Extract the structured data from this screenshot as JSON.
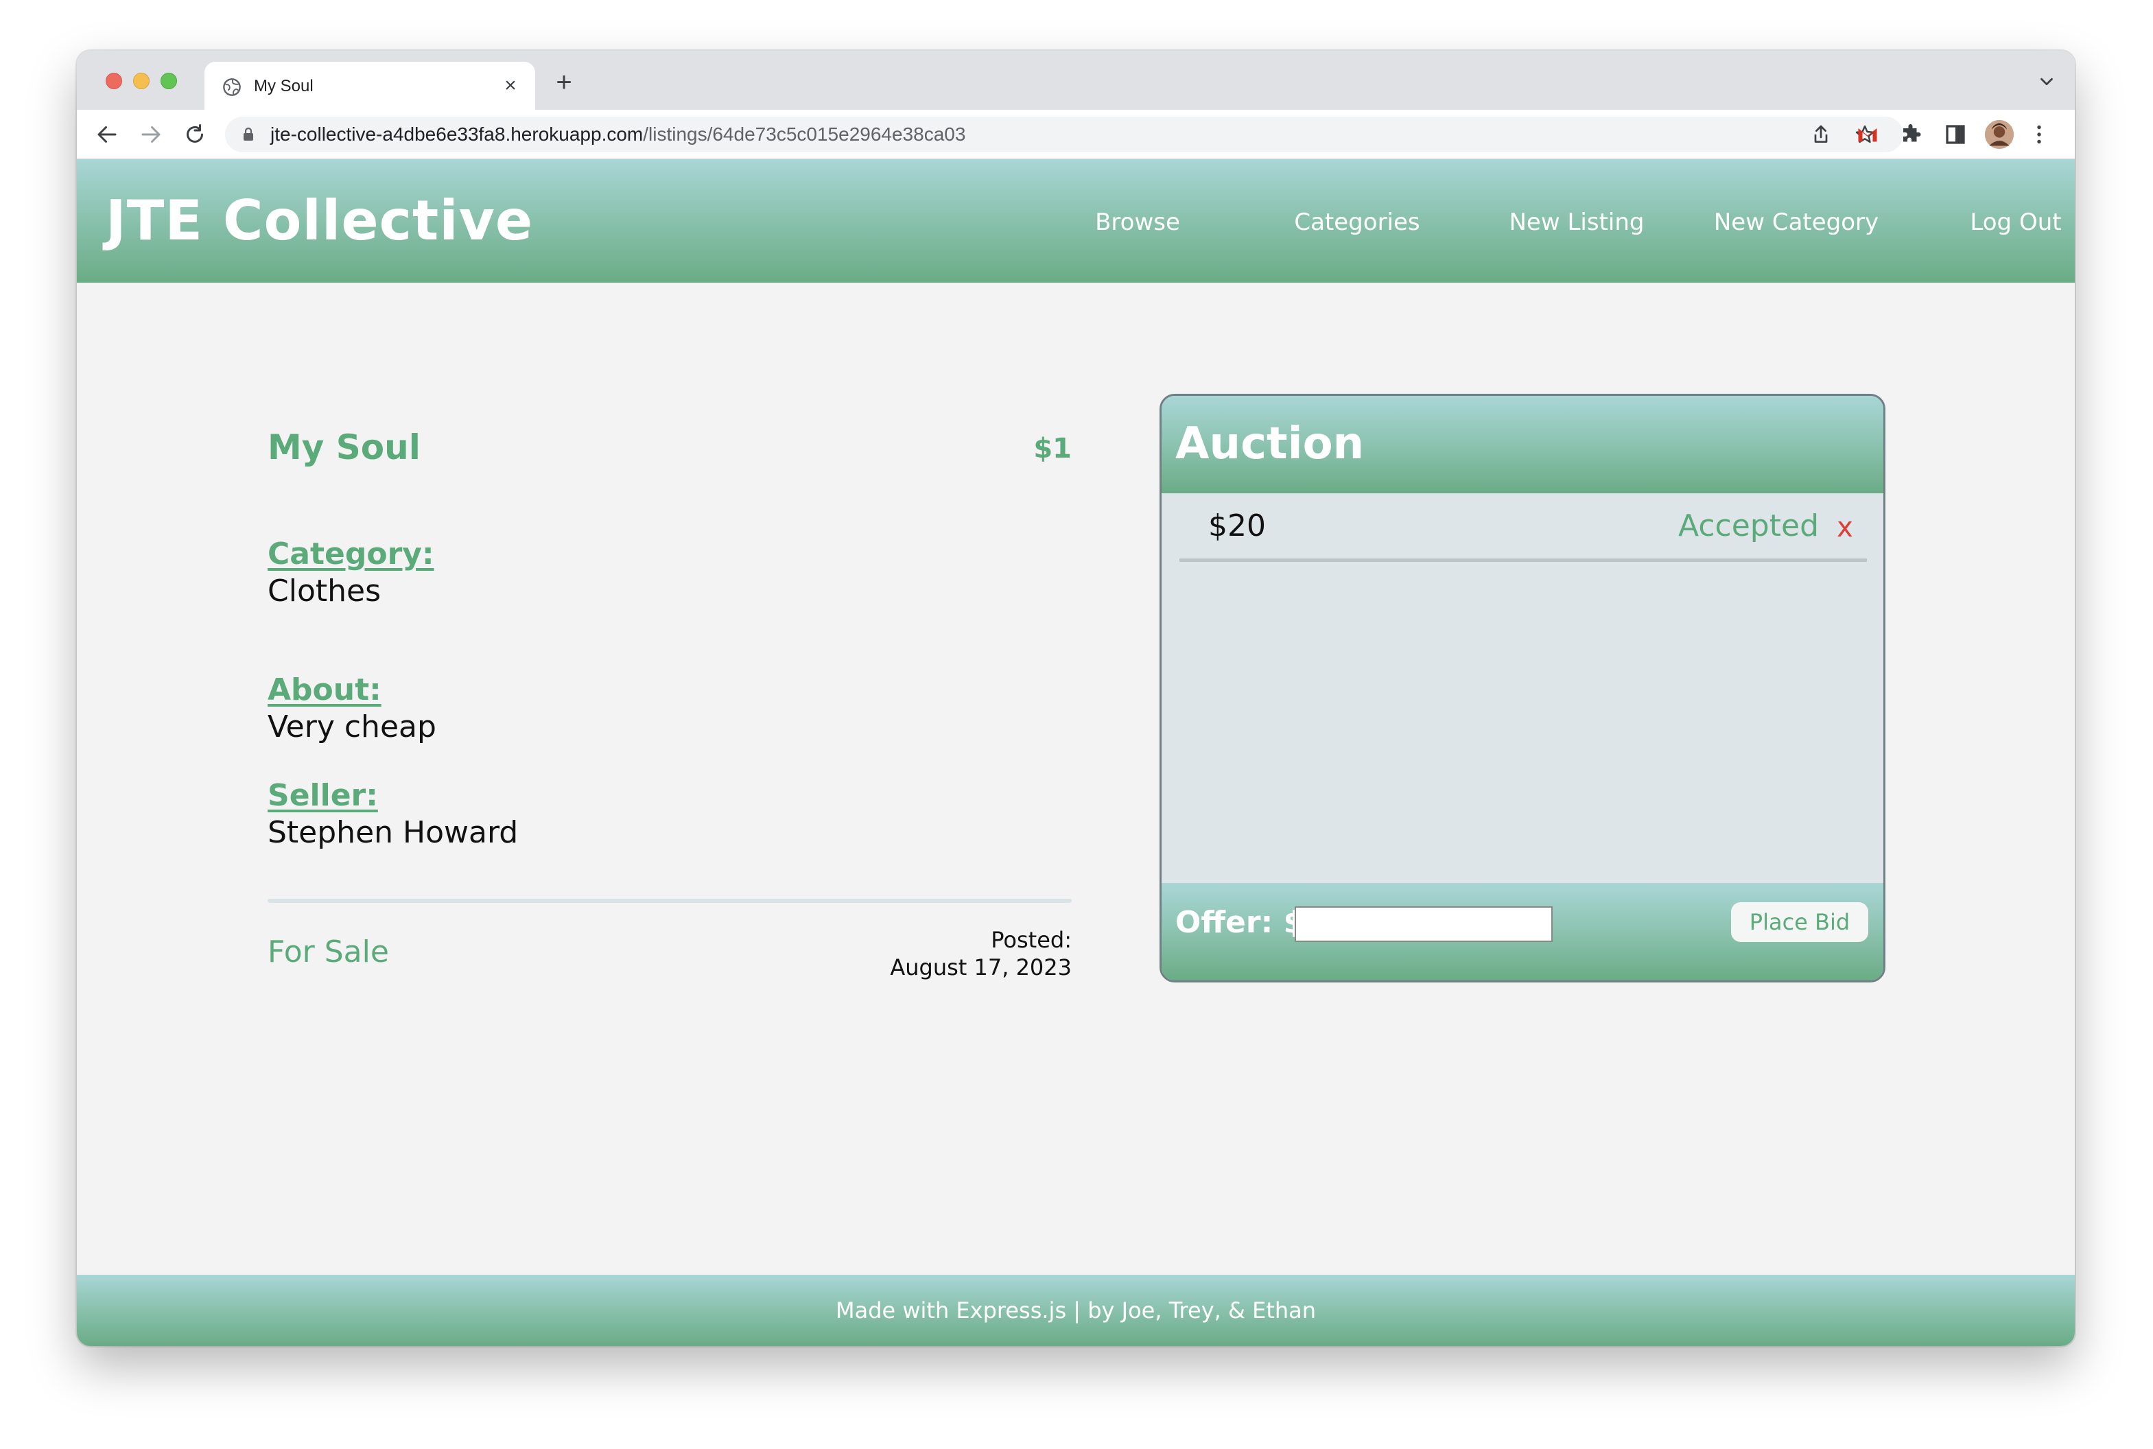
{
  "browser": {
    "tab_title": "My Soul",
    "tab_close": "×",
    "new_tab": "+",
    "url_host": "jte-collective-a4dbe6e33fa8.herokuapp.com",
    "url_path": "/listings/64de73c5c015e2964e38ca03",
    "icons": [
      "back-icon",
      "forward-icon",
      "reload-icon",
      "lock-icon",
      "share-icon",
      "bookmark-star-icon",
      "gmail-icon",
      "extensions-icon",
      "side-panel-icon",
      "profile-avatar",
      "more-menu-icon",
      "tab-search-icon"
    ]
  },
  "site": {
    "brand": "JTE Collective",
    "nav": {
      "browse": "Browse",
      "categories": "Categories",
      "new_listing": "New Listing",
      "new_category": "New Category",
      "log_out": "Log Out"
    },
    "footer": "Made with Express.js | by Joe, Trey, & Ethan"
  },
  "listing": {
    "title": "My Soul",
    "price": "$1",
    "category_label": "Category:",
    "category_value": "Clothes",
    "about_label": "About:",
    "about_value": "Very cheap",
    "seller_label": "Seller:",
    "seller_value": "Stephen Howard",
    "status": "For Sale",
    "posted_label": "Posted:",
    "posted_date": "August 17, 2023"
  },
  "auction": {
    "title": "Auction",
    "bids": [
      {
        "amount": "$20",
        "status": "Accepted",
        "delete": "x"
      }
    ],
    "offer_label": "Offer: $",
    "offer_value": "",
    "place_bid": "Place Bid"
  },
  "colors": {
    "accent_green": "#5aaa7a",
    "header_gradient_top": "#a9d6d6",
    "header_gradient_bottom": "#6aac86",
    "page_background": "#f3f3f3",
    "auction_background": "#dee5e8",
    "delete_red": "#e03b3b"
  }
}
